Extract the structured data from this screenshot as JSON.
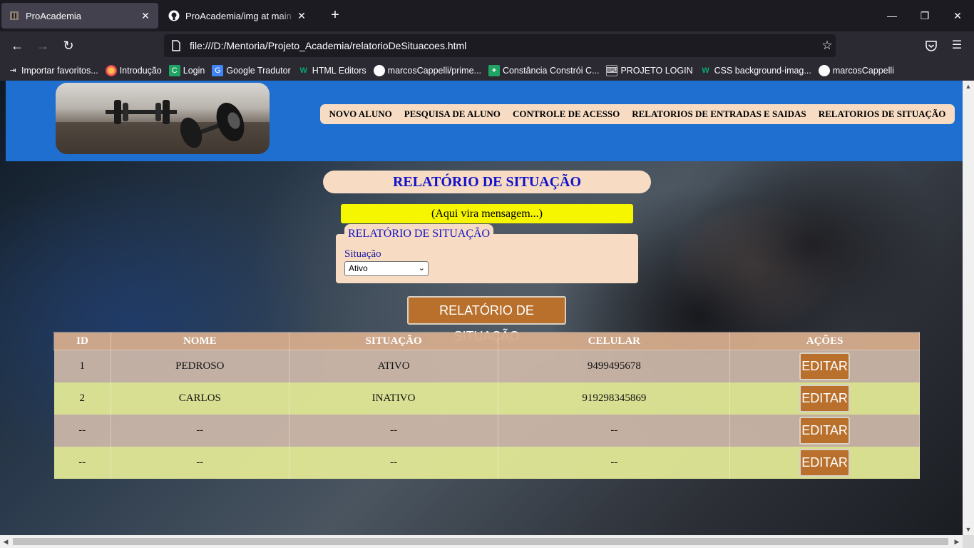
{
  "browser": {
    "tabs": [
      {
        "title": "ProAcademia",
        "active": true
      },
      {
        "title": "ProAcademia/img at main · ma",
        "active": false
      }
    ],
    "url": "file:///D:/Mentoria/Projeto_Academia/relatorioDeSituacoes.html",
    "bookmarks": [
      {
        "label": "Importar favoritos...",
        "icon": "import-icon"
      },
      {
        "label": "Introdução",
        "icon": "firefox-icon"
      },
      {
        "label": "Login",
        "icon": "login-icon"
      },
      {
        "label": "Google Tradutor",
        "icon": "translate-icon"
      },
      {
        "label": "HTML Editors",
        "icon": "w3schools-icon"
      },
      {
        "label": "marcosCappelli/prime...",
        "icon": "github-icon"
      },
      {
        "label": "Constância Constrói C...",
        "icon": "plus-icon"
      },
      {
        "label": "PROJETO LOGIN",
        "icon": "keyboard-icon"
      },
      {
        "label": "CSS background-imag...",
        "icon": "w3schools-icon"
      },
      {
        "label": "marcosCappelli",
        "icon": "github-icon"
      }
    ]
  },
  "site": {
    "menu": [
      "NOVO ALUNO",
      "PESQUISA DE ALUNO",
      "CONTROLE DE ACESSO",
      "RELATORIOS DE ENTRADAS E SAIDAS",
      "RELATORIOS DE SITUAÇÃO"
    ],
    "title": "RELATÓRIO DE SITUAÇÃO",
    "message": "(Aqui vira mensagem...)",
    "form": {
      "legend": "RELATÓRIO DE SITUAÇÃO",
      "label": "Situação",
      "selected": "Ativo"
    },
    "button": "RELATÓRIO DE SITUAÇÃO"
  },
  "table": {
    "headers": [
      "ID",
      "NOME",
      "SITUAÇÃO",
      "CELULAR",
      "AÇÕES"
    ],
    "rows": [
      {
        "id": "1",
        "nome": "PEDROSO",
        "situacao": "ATIVO",
        "celular": "9499495678",
        "acao": "EDITAR"
      },
      {
        "id": "2",
        "nome": "CARLOS",
        "situacao": "INATIVO",
        "celular": "919298345869",
        "acao": "EDITAR"
      },
      {
        "id": "--",
        "nome": "--",
        "situacao": "--",
        "celular": "--",
        "acao": "EDITAR"
      },
      {
        "id": "--",
        "nome": "--",
        "situacao": "--",
        "celular": "--",
        "acao": "EDITAR"
      }
    ]
  }
}
